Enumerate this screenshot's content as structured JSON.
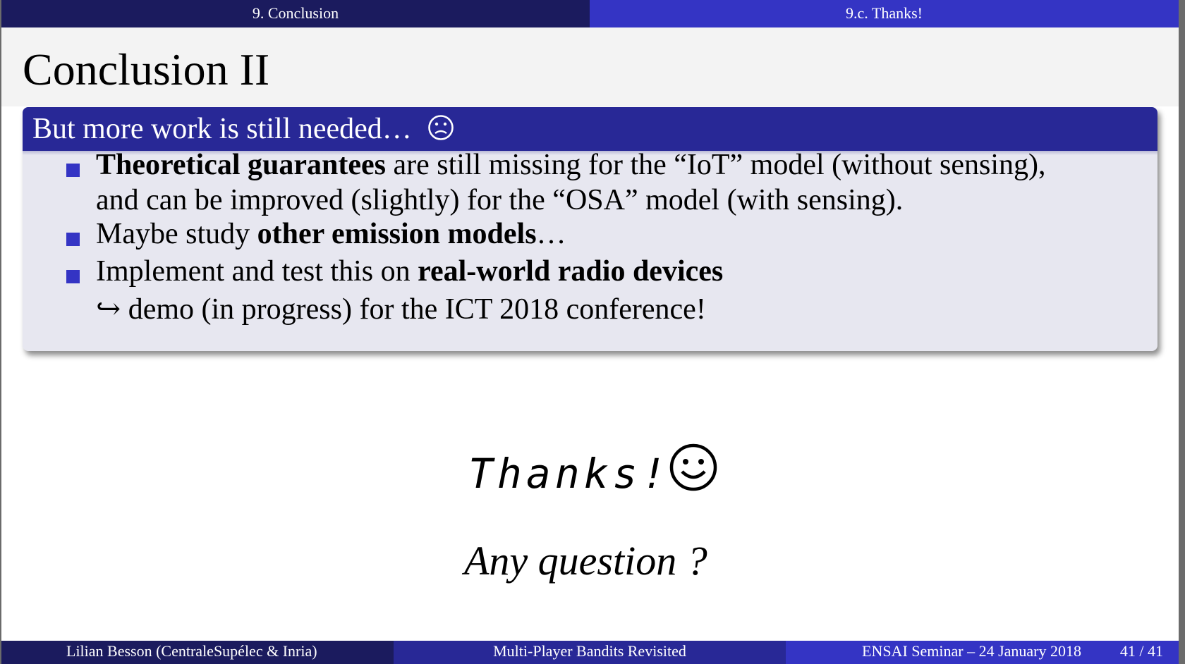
{
  "nav": {
    "section": "9. Conclusion",
    "subsection": "9.c. Thanks!"
  },
  "frame": {
    "title": "Conclusion II"
  },
  "block": {
    "title": "But more work is still needed…",
    "title_icon": "frowning-face-icon",
    "items": [
      {
        "bold": "Theoretical guarantees",
        "rest": " are still missing for the “IoT” model (without sensing),",
        "line2": "and can be improved (slightly) for the “OSA” model (with sensing)."
      },
      {
        "pre": "Maybe study ",
        "bold": "other emission models",
        "post": "…"
      },
      {
        "pre": "Implement and test this on ",
        "bold": "real-world radio devices",
        "line2_arrow": "↪",
        "line2": " demo (in progress) for the ICT 2018 conference!"
      }
    ],
    "bullet_color": "#3434c4",
    "header_color": "#282896"
  },
  "thanks": {
    "text": "Thanks!",
    "icon": "smiling-face-icon"
  },
  "question": "Any question ?",
  "footer": {
    "author": "Lilian Besson  (CentraleSupélec & Inria)",
    "talk": "Multi-Player Bandits Revisited",
    "event": "ENSAI Seminar – 24 January 2018",
    "page": "41 / 41"
  }
}
